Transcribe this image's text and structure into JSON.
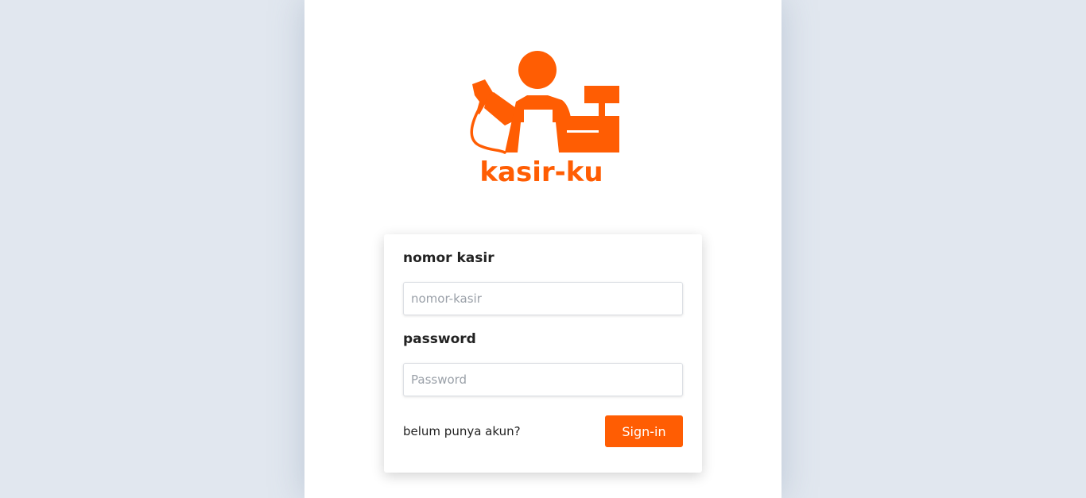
{
  "brand": {
    "name": "kasir-ku",
    "color": "#ff5d03",
    "logo_icon": "cashier-icon"
  },
  "form": {
    "kasir_label": "nomor kasir",
    "kasir_placeholder": "nomor-kasir",
    "kasir_value": "",
    "password_label": "password",
    "password_placeholder": "Password",
    "password_value": "",
    "register_link": "belum punya akun?",
    "submit_label": "Sign-in"
  }
}
